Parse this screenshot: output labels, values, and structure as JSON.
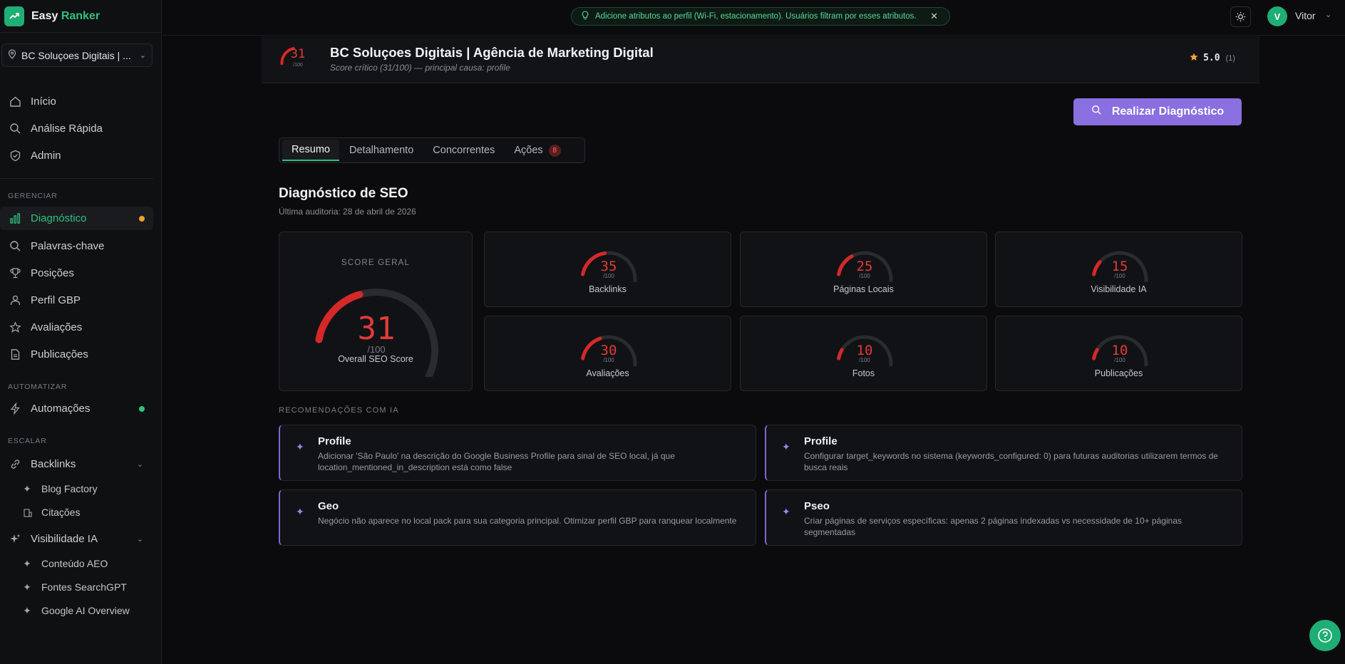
{
  "brand": {
    "name_part1": "Easy",
    "name_part2": "Ranker"
  },
  "location_select": {
    "value": "BC Soluçoes Digitais | ..."
  },
  "nav": {
    "main": [
      {
        "label": "Início",
        "icon": "home-icon"
      },
      {
        "label": "Análise Rápida",
        "icon": "search-icon"
      },
      {
        "label": "Admin",
        "icon": "shield-icon"
      }
    ],
    "section_manage": "GERENCIAR",
    "manage": [
      {
        "label": "Diagnóstico",
        "icon": "bar-chart-icon",
        "active": true
      },
      {
        "label": "Palavras-chave",
        "icon": "search-icon"
      },
      {
        "label": "Posições",
        "icon": "trophy-icon"
      },
      {
        "label": "Perfil GBP",
        "icon": "user-icon"
      },
      {
        "label": "Avaliações",
        "icon": "star-icon"
      },
      {
        "label": "Publicações",
        "icon": "document-icon"
      }
    ],
    "section_automate": "AUTOMATIZAR",
    "automate": [
      {
        "label": "Automações",
        "icon": "lightning-icon"
      }
    ],
    "section_scale": "ESCALAR",
    "backlinks": {
      "label": "Backlinks",
      "icon": "link-icon",
      "children": [
        "Blog Factory",
        "Citações"
      ]
    },
    "ai_visibility": {
      "label": "Visibilidade IA",
      "icon": "sparkles-icon",
      "children": [
        "Conteúdo AEO",
        "Fontes SearchGPT",
        "Google AI Overview"
      ]
    }
  },
  "topbar": {
    "notice": "Adicione atributos ao perfil (Wi-Fi, estacionamento). Usuários filtram por esses atributos.",
    "user_initial": "V",
    "user_name": "Vitor"
  },
  "business": {
    "score": "31",
    "score_max": "/100",
    "title": "BC Soluçoes Digitais | Agência de Marketing Digital",
    "subtitle": "Score crítico (31/100) — principal causa: profile",
    "rating": "5.0",
    "rating_count": "(1)"
  },
  "cta_label": "Realizar Diagnóstico",
  "tabs": [
    {
      "label": "Resumo",
      "active": true
    },
    {
      "label": "Detalhamento"
    },
    {
      "label": "Concorrentes"
    },
    {
      "label": "Ações",
      "badge": "8"
    }
  ],
  "seo": {
    "title": "Diagnóstico de SEO",
    "last_audit": "Última auditoria: 28 de abril de 2026",
    "overall": {
      "label": "SCORE GERAL",
      "value": 31,
      "max": "/100",
      "caption": "Overall SEO Score"
    },
    "metrics": [
      {
        "name": "Backlinks",
        "value": 35,
        "max": "/100"
      },
      {
        "name": "Páginas Locais",
        "value": 25,
        "max": "/100"
      },
      {
        "name": "Visibilidade IA",
        "value": 15,
        "max": "/100"
      },
      {
        "name": "Avaliações",
        "value": 30,
        "max": "/100"
      },
      {
        "name": "Fotos",
        "value": 10,
        "max": "/100"
      },
      {
        "name": "Publicações",
        "value": 10,
        "max": "/100"
      }
    ]
  },
  "recommendations": {
    "label": "RECOMENDAÇÕES COM IA",
    "items": [
      {
        "title": "Profile",
        "text": "Adicionar 'São Paulo' na descrição do Google Business Profile para sinal de SEO local, já que location_mentioned_in_description está como false"
      },
      {
        "title": "Profile",
        "text": "Configurar target_keywords no sistema (keywords_configured: 0) para futuras auditorias utilizarem termos de busca reais"
      },
      {
        "title": "Geo",
        "text": "Negócio não aparece no local pack para sua categoria principal. Otimizar perfil GBP para ranquear localmente"
      },
      {
        "title": "Pseo",
        "text": "Criar páginas de serviços específicas: apenas 2 páginas indexadas vs necessidade de 10+ páginas segmentadas"
      }
    ]
  },
  "colors": {
    "accent_green": "#2ec27e",
    "critical_red": "#e23a3a",
    "purple": "#8a6fe0",
    "status_orange": "#f0a030"
  }
}
